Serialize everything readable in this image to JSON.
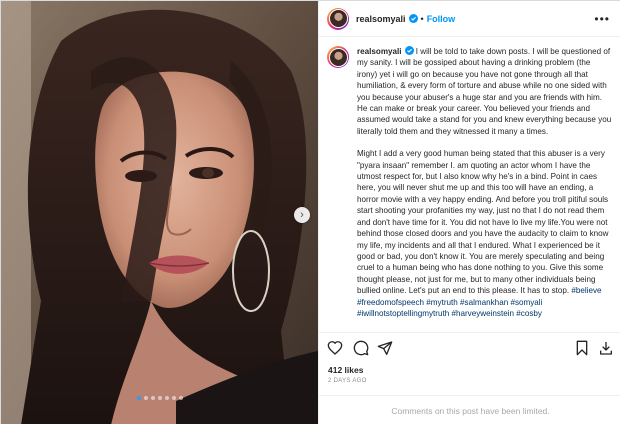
{
  "post": {
    "username": "realsomyali",
    "header_separator": "•",
    "follow_label": "Follow",
    "more_icon": "more-options-icon",
    "verified_color": "#0095f6",
    "accent_color": "#0095f6"
  },
  "media": {
    "slide_count": 7,
    "active_slide": 1,
    "next_icon": "chevron-right-icon"
  },
  "caption": {
    "username": "realsomyali",
    "paragraph_1": " I will be told to take down posts. I will be questioned of my sanity. I will be gossiped about having a drinking problem (the irony) yet i will go on because you have not gone through all that humiliation, & every form of torture and abuse while no one sided with you because your abuser's a huge star and you are friends with him. He can make or break your career. You believed your friends and assumed would take a stand for you and knew everything because you literally told them and they witnessed it many a times.",
    "paragraph_2": "Might I add a very good human being stated that this abuser is a very \"pyara insaan\" remember I. am quoting an actor whom I have the utmost respect for, but I also know why he's in a bind. Point in caes here, you will never shut me up and this too will have an ending, a horror movie with a vey happy ending. And before you troll pitiful souls start shooting your profanities my way, just no that I do not read them and don't have time for it. You did not have lo live my life.You were not behind those closed doors and you have the audacity to claim to know my life, my incidents and all that I endured. What I experienced be it good or bad, you don't know it. You are merely speculating and being cruel to a human being who has done nothing to you. Give this some thought please, not just for me, but to many other individuals being bullied online. Let's put an end to this please. It has to stop.",
    "hashtags": [
      "#believe",
      "#freedomofspeech",
      "#mytruth",
      "#salmankhan",
      "#somyali",
      "#iwillnotstoptellingmytruth",
      "#harveyweinstein",
      "#cosby"
    ]
  },
  "actions": {
    "like_icon": "heart-icon",
    "comment_icon": "comment-icon",
    "share_icon": "share-icon",
    "save_icon": "bookmark-icon",
    "download_icon": "download-icon"
  },
  "likes_label": "412 likes",
  "timestamp": "2 DAYS AGO",
  "comments_disabled": "Comments on this post have been limited."
}
